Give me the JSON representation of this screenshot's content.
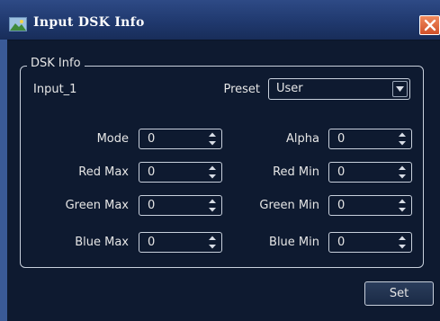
{
  "window": {
    "title": "Input DSK Info",
    "accent_color": "#2e4a86",
    "close_color": "#d0502a"
  },
  "group": {
    "title": "DSK Info"
  },
  "input_name": "Input_1",
  "preset": {
    "label": "Preset",
    "value": "User"
  },
  "fields": {
    "mode": {
      "label": "Mode",
      "value": "0"
    },
    "alpha": {
      "label": "Alpha",
      "value": "0"
    },
    "red_max": {
      "label": "Red Max",
      "value": "0"
    },
    "red_min": {
      "label": "Red Min",
      "value": "0"
    },
    "green_max": {
      "label": "Green Max",
      "value": "0"
    },
    "green_min": {
      "label": "Green Min",
      "value": "0"
    },
    "blue_max": {
      "label": "Blue Max",
      "value": "0"
    },
    "blue_min": {
      "label": "Blue Min",
      "value": "0"
    }
  },
  "buttons": {
    "set": "Set"
  },
  "icons": {
    "app": "app-window-icon",
    "close": "close-icon",
    "spin": "spin-arrows-icon",
    "dropdown": "chevron-down-icon"
  }
}
